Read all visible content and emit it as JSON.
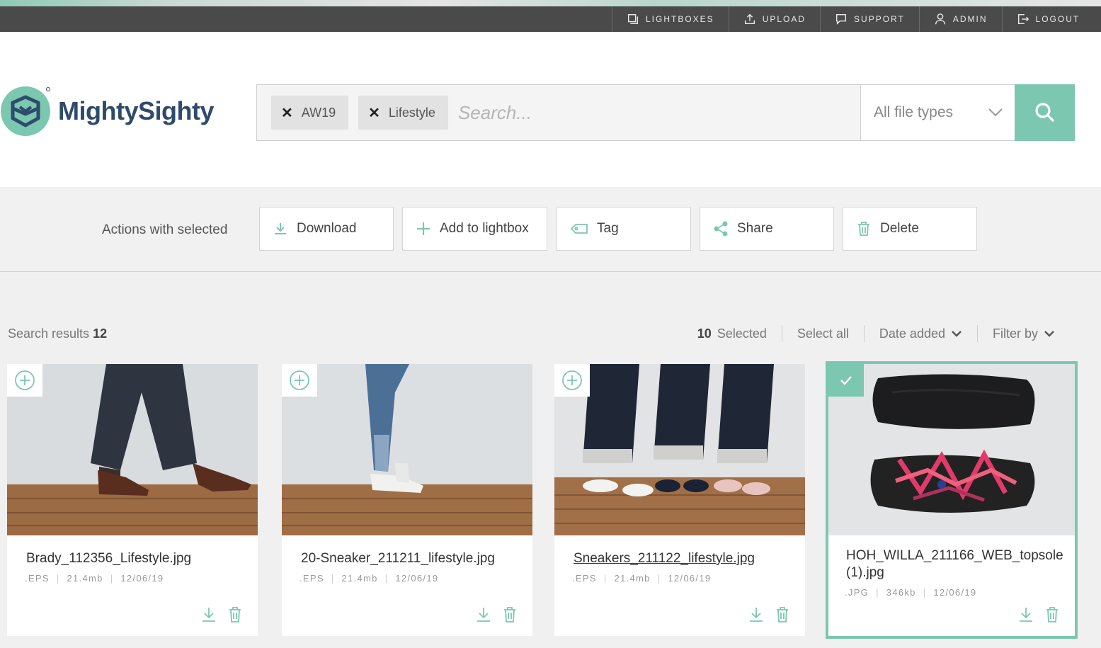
{
  "nav": {
    "items": [
      {
        "label": "Lightboxes",
        "icon": "lightbox-icon"
      },
      {
        "label": "Upload",
        "icon": "upload-icon"
      },
      {
        "label": "Support",
        "icon": "chat-icon"
      },
      {
        "label": "Admin",
        "icon": "user-icon"
      },
      {
        "label": "Logout",
        "icon": "logout-icon"
      }
    ]
  },
  "logo": {
    "text": "MightySighty"
  },
  "search": {
    "chips": [
      {
        "label": "AW19"
      },
      {
        "label": "Lifestyle"
      }
    ],
    "placeholder": "Search...",
    "value": "",
    "filetype": "All file types"
  },
  "actions": {
    "label": "Actions with selected",
    "buttons": [
      {
        "label": "Download",
        "icon": "download-icon"
      },
      {
        "label": "Add to lightbox",
        "icon": "plus-icon"
      },
      {
        "label": "Tag",
        "icon": "tag-icon"
      },
      {
        "label": "Share",
        "icon": "share-icon"
      },
      {
        "label": "Delete",
        "icon": "trash-icon"
      }
    ]
  },
  "results": {
    "label": "Search results",
    "count": "12",
    "selected_count": "10",
    "selected_label": "Selected",
    "select_all": "Select all",
    "sort": "Date added",
    "filter": "Filter by"
  },
  "colors": {
    "accent": "#7cc7b0",
    "topbar": "#4a4a4a",
    "brand": "#2f4b6b"
  },
  "cards": [
    {
      "name": "Brady_112356_Lifestyle.jpg",
      "type": ".EPS",
      "size": "21.4mb",
      "date": "12/06/19",
      "selected": false
    },
    {
      "name": "20-Sneaker_211211_lifestyle.jpg",
      "type": ".EPS",
      "size": "21.4mb",
      "date": "12/06/19",
      "selected": false
    },
    {
      "name": "Sneakers_211122_lifestyle.jpg",
      "type": ".EPS",
      "size": "21.4mb",
      "date": "12/06/19",
      "selected": false
    },
    {
      "name": "HOH_WILLA_211166_WEB_topsole (1).jpg",
      "type": ".JPG",
      "size": "346kb",
      "date": "12/06/19",
      "selected": true
    }
  ]
}
